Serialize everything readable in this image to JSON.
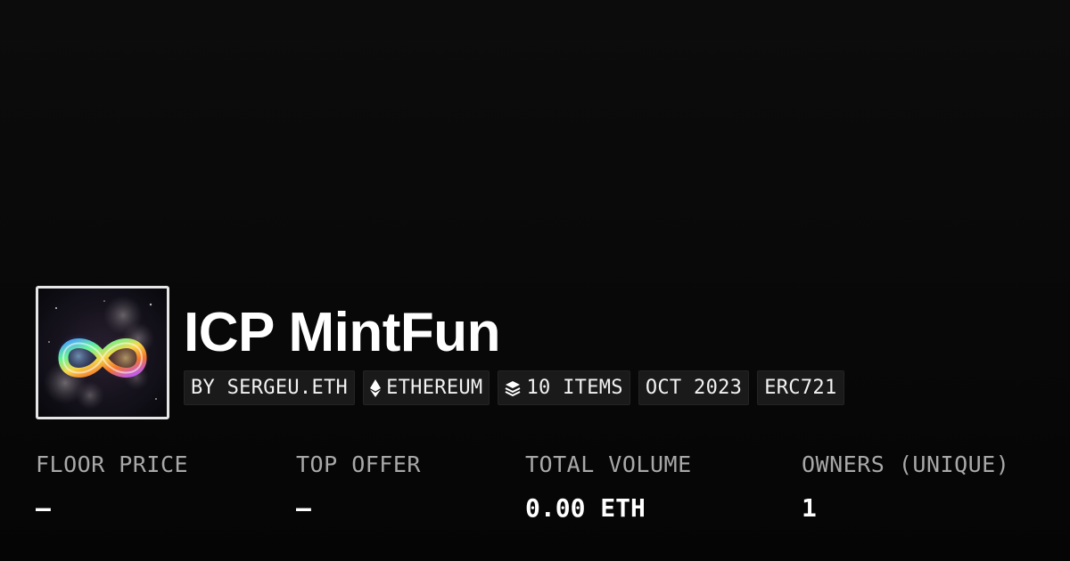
{
  "collection": {
    "title": "ICP MintFun",
    "thumbnail_icon": "infinity-nebula-artwork"
  },
  "tags": {
    "creator": "BY SERGEU.ETH",
    "chain": "ETHEREUM",
    "chain_icon": "ethereum-icon",
    "items": "10 ITEMS",
    "items_icon": "layers-icon",
    "date": "OCT 2023",
    "standard": "ERC721"
  },
  "stats": {
    "floor_price": {
      "label": "FLOOR PRICE",
      "value": "–"
    },
    "top_offer": {
      "label": "TOP OFFER",
      "value": "–"
    },
    "total_volume": {
      "label": "TOTAL VOLUME",
      "value": "0.00 ETH"
    },
    "owners": {
      "label": "OWNERS (UNIQUE)",
      "value": "1"
    }
  }
}
